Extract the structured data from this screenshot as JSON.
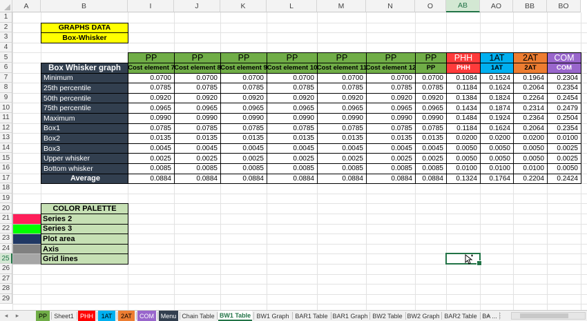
{
  "columns": [
    "A",
    "B",
    "I",
    "J",
    "K",
    "L",
    "M",
    "N",
    "O",
    "AB",
    "AO",
    "BB",
    "BO"
  ],
  "selected_column": "AB",
  "rows": [
    "1",
    "2",
    "3",
    "4",
    "5",
    "6",
    "7",
    "8",
    "9",
    "10",
    "11",
    "12",
    "13",
    "14",
    "15",
    "16",
    "17",
    "18",
    "19",
    "20",
    "21",
    "22",
    "23",
    "24",
    "25",
    "26",
    "27",
    "28",
    "29"
  ],
  "selected_row": "25",
  "graphs_title": "GRAPHS DATA",
  "graphs_subtitle": "Box-Whisker",
  "table": {
    "title": "Box Whisker graph",
    "groups": [
      {
        "name": "PP",
        "sub": "Cost element 7"
      },
      {
        "name": "PP",
        "sub": "Cost element 8"
      },
      {
        "name": "PP",
        "sub": "Cost element 9"
      },
      {
        "name": "PP",
        "sub": "Cost element 10"
      },
      {
        "name": "PP",
        "sub": "Cost element 11"
      },
      {
        "name": "PP",
        "sub": "Cost element 12"
      },
      {
        "name": "PP",
        "sub": "PP"
      },
      {
        "name": "PHH",
        "sub": "PHH"
      },
      {
        "name": "1AT",
        "sub": "1AT"
      },
      {
        "name": "2AT",
        "sub": "2AT"
      },
      {
        "name": "COM",
        "sub": "COM"
      }
    ],
    "rows": [
      {
        "label": "Minimum",
        "values": [
          "0.0700",
          "0.0700",
          "0.0700",
          "0.0700",
          "0.0700",
          "0.0700",
          "0.0700",
          "0.1084",
          "0.1524",
          "0.1964",
          "0.2304"
        ]
      },
      {
        "label": "25th percentile",
        "values": [
          "0.0785",
          "0.0785",
          "0.0785",
          "0.0785",
          "0.0785",
          "0.0785",
          "0.0785",
          "0.1184",
          "0.1624",
          "0.2064",
          "0.2354"
        ]
      },
      {
        "label": "50th percentile",
        "values": [
          "0.0920",
          "0.0920",
          "0.0920",
          "0.0920",
          "0.0920",
          "0.0920",
          "0.0920",
          "0.1384",
          "0.1824",
          "0.2264",
          "0.2454"
        ]
      },
      {
        "label": "75th percentile",
        "values": [
          "0.0965",
          "0.0965",
          "0.0965",
          "0.0965",
          "0.0965",
          "0.0965",
          "0.0965",
          "0.1434",
          "0.1874",
          "0.2314",
          "0.2479"
        ]
      },
      {
        "label": "Maximum",
        "values": [
          "0.0990",
          "0.0990",
          "0.0990",
          "0.0990",
          "0.0990",
          "0.0990",
          "0.0990",
          "0.1484",
          "0.1924",
          "0.2364",
          "0.2504"
        ]
      },
      {
        "label": "Box1",
        "values": [
          "0.0785",
          "0.0785",
          "0.0785",
          "0.0785",
          "0.0785",
          "0.0785",
          "0.0785",
          "0.1184",
          "0.1624",
          "0.2064",
          "0.2354"
        ]
      },
      {
        "label": "Box2",
        "values": [
          "0.0135",
          "0.0135",
          "0.0135",
          "0.0135",
          "0.0135",
          "0.0135",
          "0.0135",
          "0.0200",
          "0.0200",
          "0.0200",
          "0.0100"
        ]
      },
      {
        "label": "Box3",
        "values": [
          "0.0045",
          "0.0045",
          "0.0045",
          "0.0045",
          "0.0045",
          "0.0045",
          "0.0045",
          "0.0050",
          "0.0050",
          "0.0050",
          "0.0025"
        ]
      },
      {
        "label": "Upper whisker",
        "values": [
          "0.0025",
          "0.0025",
          "0.0025",
          "0.0025",
          "0.0025",
          "0.0025",
          "0.0025",
          "0.0050",
          "0.0050",
          "0.0050",
          "0.0025"
        ]
      },
      {
        "label": "Bottom whisker",
        "values": [
          "0.0085",
          "0.0085",
          "0.0085",
          "0.0085",
          "0.0085",
          "0.0085",
          "0.0085",
          "0.0100",
          "0.0100",
          "0.0100",
          "0.0050"
        ]
      }
    ],
    "average": {
      "label": "Average",
      "values": [
        "0.0884",
        "0.0884",
        "0.0884",
        "0.0884",
        "0.0884",
        "0.0884",
        "0.0884",
        "0.1324",
        "0.1764",
        "0.2204",
        "0.2424"
      ]
    }
  },
  "palette": {
    "title": "COLOR PALETTE",
    "items": [
      {
        "label": "Series 2",
        "color": "#ff1f5a"
      },
      {
        "label": "Series 3",
        "color": "#00ff00"
      },
      {
        "label": "Plot area",
        "color": "#203864"
      },
      {
        "label": "Axis",
        "color": "#808080"
      },
      {
        "label": "Grid lines",
        "color": "#a6a6a6"
      }
    ]
  },
  "tabs": [
    "PP",
    "Sheet1",
    "PHH",
    "1AT",
    "2AT",
    "COM",
    "Menu",
    "Chain Table",
    "BW1 Table",
    "BW1 Graph",
    "BAR1 Table",
    "BAR1 Graph",
    "BW2 Table",
    "BW2 Graph",
    "BAR2 Table",
    "BA ..."
  ],
  "active_tab": "BW1 Table",
  "tab_nav": {
    "prev": "◂",
    "next": "▸",
    "add": "+",
    "more": "⋮"
  }
}
